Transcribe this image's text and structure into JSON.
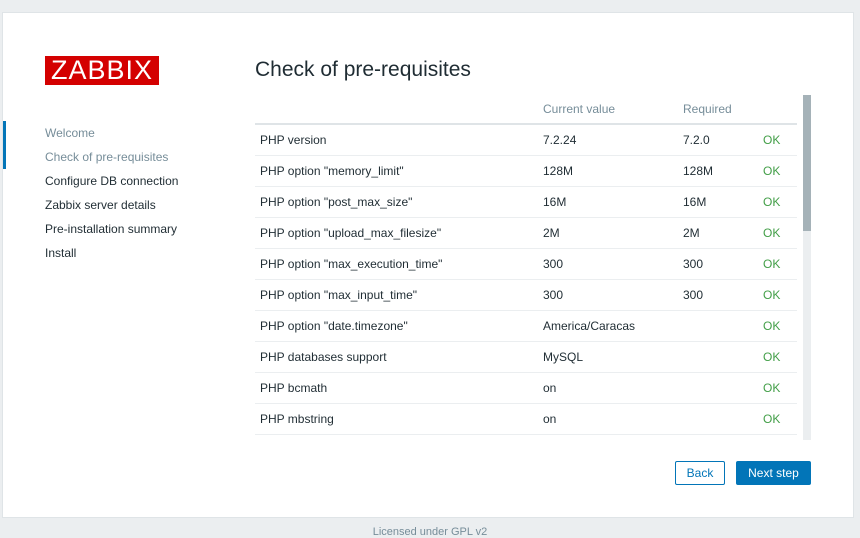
{
  "logo": "ZABBIX",
  "sidebar": {
    "items": [
      {
        "label": "Welcome"
      },
      {
        "label": "Check of pre-requisites"
      },
      {
        "label": "Configure DB connection"
      },
      {
        "label": "Zabbix server details"
      },
      {
        "label": "Pre-installation summary"
      },
      {
        "label": "Install"
      }
    ]
  },
  "main": {
    "title": "Check of pre-requisites",
    "columns": [
      "",
      "Current value",
      "Required",
      ""
    ],
    "rows": [
      {
        "name": "PHP version",
        "current": "7.2.24",
        "required": "7.2.0",
        "status": "OK"
      },
      {
        "name": "PHP option \"memory_limit\"",
        "current": "128M",
        "required": "128M",
        "status": "OK"
      },
      {
        "name": "PHP option \"post_max_size\"",
        "current": "16M",
        "required": "16M",
        "status": "OK"
      },
      {
        "name": "PHP option \"upload_max_filesize\"",
        "current": "2M",
        "required": "2M",
        "status": "OK"
      },
      {
        "name": "PHP option \"max_execution_time\"",
        "current": "300",
        "required": "300",
        "status": "OK"
      },
      {
        "name": "PHP option \"max_input_time\"",
        "current": "300",
        "required": "300",
        "status": "OK"
      },
      {
        "name": "PHP option \"date.timezone\"",
        "current": "America/Caracas",
        "required": "",
        "status": "OK"
      },
      {
        "name": "PHP databases support",
        "current": "MySQL",
        "required": "",
        "status": "OK"
      },
      {
        "name": "PHP bcmath",
        "current": "on",
        "required": "",
        "status": "OK"
      },
      {
        "name": "PHP mbstring",
        "current": "on",
        "required": "",
        "status": "OK"
      }
    ]
  },
  "buttons": {
    "back": "Back",
    "next": "Next step"
  },
  "footer": "Licensed under GPL v2",
  "colors": {
    "brand": "#d40000",
    "accent": "#0275b8",
    "ok": "#429e47"
  }
}
